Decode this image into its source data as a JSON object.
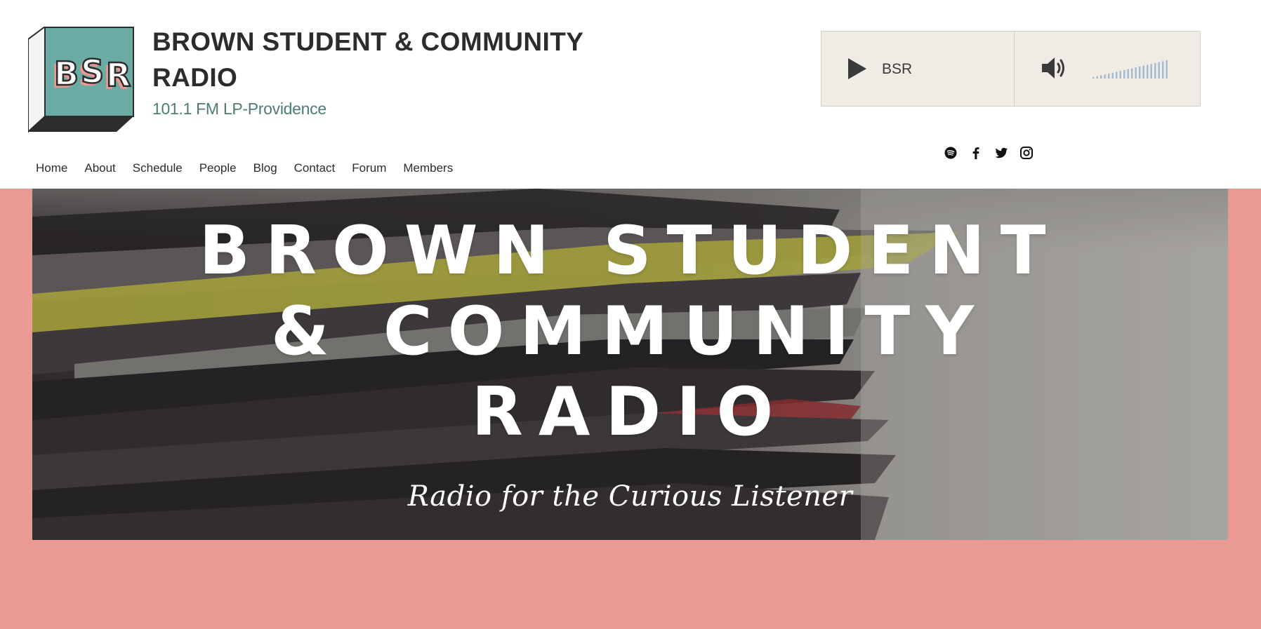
{
  "header": {
    "title": "BROWN STUDENT & COMMUNITY RADIO",
    "subtitle": "101.1 FM LP-Providence",
    "logo_text": "BSR"
  },
  "player": {
    "station": "BSR",
    "play_icon": "play-icon",
    "volume_icon": "volume-icon",
    "volume_level": 1.0
  },
  "social": [
    {
      "name": "Spotify",
      "icon": "spotify-icon"
    },
    {
      "name": "Facebook",
      "icon": "facebook-icon"
    },
    {
      "name": "Twitter",
      "icon": "twitter-icon"
    },
    {
      "name": "Instagram",
      "icon": "instagram-icon"
    }
  ],
  "nav": {
    "items": [
      {
        "label": "Home"
      },
      {
        "label": "About"
      },
      {
        "label": "Schedule"
      },
      {
        "label": "People"
      },
      {
        "label": "Blog"
      },
      {
        "label": "Contact"
      },
      {
        "label": "Forum"
      },
      {
        "label": "Members"
      }
    ]
  },
  "hero": {
    "title_lines": [
      "BROWN STUDENT",
      "& COMMUNITY",
      "RADIO"
    ],
    "tagline": "Radio for the Curious Listener"
  },
  "colors": {
    "accent_pink": "#ea9a92",
    "teal": "#6aaca4",
    "subtitle_teal": "#4f7c76",
    "player_bg": "#efebe5",
    "volume_blue": "#a4b9d1"
  }
}
